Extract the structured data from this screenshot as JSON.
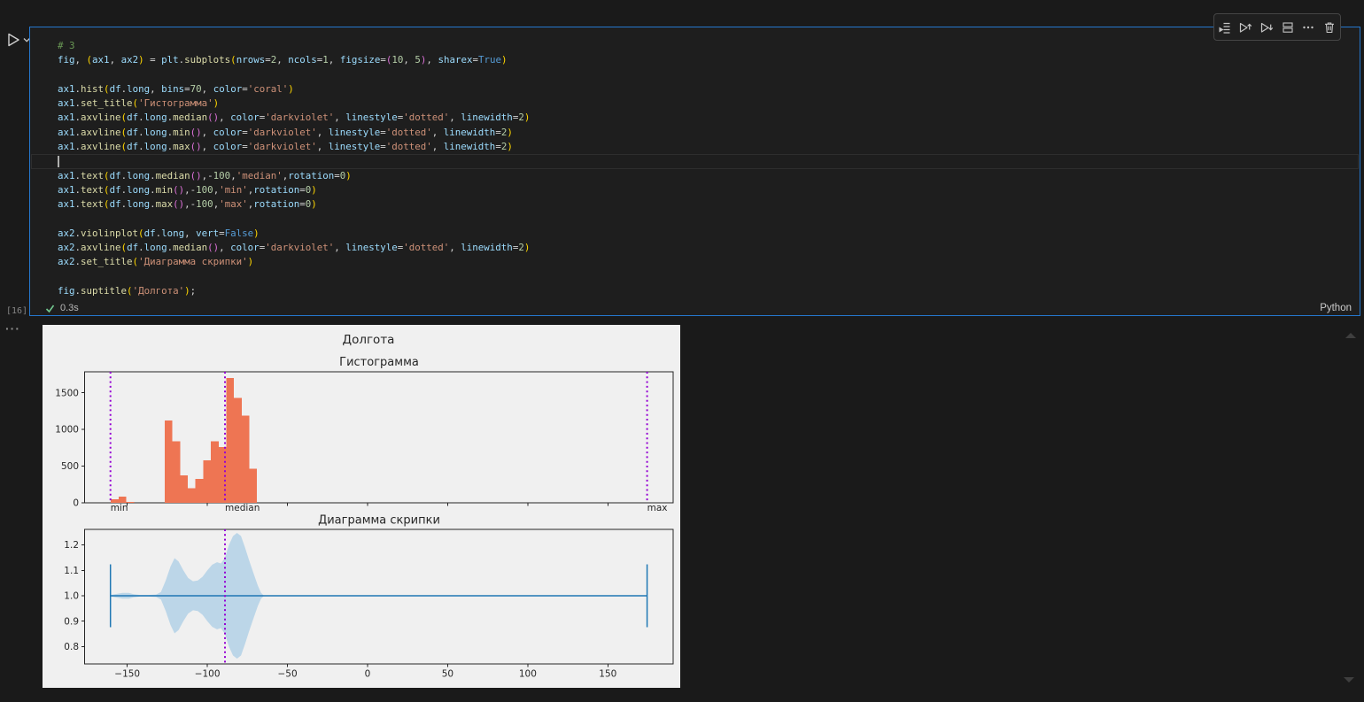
{
  "cell": {
    "execution_count": "[16]",
    "status": {
      "success": true,
      "duration": "0.3s",
      "language": "Python"
    },
    "cursor_line": 8,
    "code_lines": [
      [
        [
          "c",
          "# 3"
        ]
      ],
      [
        [
          "v",
          "fig"
        ],
        [
          "p",
          ", "
        ],
        [
          "b1",
          "("
        ],
        [
          "v",
          "ax1"
        ],
        [
          "p",
          ", "
        ],
        [
          "v",
          "ax2"
        ],
        [
          "b1",
          ")"
        ],
        [
          "p",
          " = "
        ],
        [
          "v",
          "plt"
        ],
        [
          "p",
          "."
        ],
        [
          "f",
          "subplots"
        ],
        [
          "b1",
          "("
        ],
        [
          "v",
          "nrows"
        ],
        [
          "p",
          "="
        ],
        [
          "n",
          "2"
        ],
        [
          "p",
          ", "
        ],
        [
          "v",
          "ncols"
        ],
        [
          "p",
          "="
        ],
        [
          "n",
          "1"
        ],
        [
          "p",
          ", "
        ],
        [
          "v",
          "figsize"
        ],
        [
          "p",
          "="
        ],
        [
          "b2",
          "("
        ],
        [
          "n",
          "10"
        ],
        [
          "p",
          ", "
        ],
        [
          "n",
          "5"
        ],
        [
          "b2",
          ")"
        ],
        [
          "p",
          ", "
        ],
        [
          "v",
          "sharex"
        ],
        [
          "p",
          "="
        ],
        [
          "k",
          "True"
        ],
        [
          "b1",
          ")"
        ]
      ],
      [],
      [
        [
          "v",
          "ax1"
        ],
        [
          "p",
          "."
        ],
        [
          "f",
          "hist"
        ],
        [
          "b1",
          "("
        ],
        [
          "v",
          "df"
        ],
        [
          "p",
          "."
        ],
        [
          "v",
          "long"
        ],
        [
          "p",
          ", "
        ],
        [
          "v",
          "bins"
        ],
        [
          "p",
          "="
        ],
        [
          "n",
          "70"
        ],
        [
          "p",
          ", "
        ],
        [
          "v",
          "color"
        ],
        [
          "p",
          "="
        ],
        [
          "s",
          "'coral'"
        ],
        [
          "b1",
          ")"
        ]
      ],
      [
        [
          "v",
          "ax1"
        ],
        [
          "p",
          "."
        ],
        [
          "f",
          "set_title"
        ],
        [
          "b1",
          "("
        ],
        [
          "s",
          "'Гистограмма'"
        ],
        [
          "b1",
          ")"
        ]
      ],
      [
        [
          "v",
          "ax1"
        ],
        [
          "p",
          "."
        ],
        [
          "f",
          "axvline"
        ],
        [
          "b1",
          "("
        ],
        [
          "v",
          "df"
        ],
        [
          "p",
          "."
        ],
        [
          "v",
          "long"
        ],
        [
          "p",
          "."
        ],
        [
          "f",
          "median"
        ],
        [
          "b2",
          "()"
        ],
        [
          "p",
          ", "
        ],
        [
          "v",
          "color"
        ],
        [
          "p",
          "="
        ],
        [
          "s",
          "'darkviolet'"
        ],
        [
          "p",
          ", "
        ],
        [
          "v",
          "linestyle"
        ],
        [
          "p",
          "="
        ],
        [
          "s",
          "'dotted'"
        ],
        [
          "p",
          ", "
        ],
        [
          "v",
          "linewidth"
        ],
        [
          "p",
          "="
        ],
        [
          "n",
          "2"
        ],
        [
          "b1",
          ")"
        ]
      ],
      [
        [
          "v",
          "ax1"
        ],
        [
          "p",
          "."
        ],
        [
          "f",
          "axvline"
        ],
        [
          "b1",
          "("
        ],
        [
          "v",
          "df"
        ],
        [
          "p",
          "."
        ],
        [
          "v",
          "long"
        ],
        [
          "p",
          "."
        ],
        [
          "f",
          "min"
        ],
        [
          "b2",
          "()"
        ],
        [
          "p",
          ", "
        ],
        [
          "v",
          "color"
        ],
        [
          "p",
          "="
        ],
        [
          "s",
          "'darkviolet'"
        ],
        [
          "p",
          ", "
        ],
        [
          "v",
          "linestyle"
        ],
        [
          "p",
          "="
        ],
        [
          "s",
          "'dotted'"
        ],
        [
          "p",
          ", "
        ],
        [
          "v",
          "linewidth"
        ],
        [
          "p",
          "="
        ],
        [
          "n",
          "2"
        ],
        [
          "b1",
          ")"
        ]
      ],
      [
        [
          "v",
          "ax1"
        ],
        [
          "p",
          "."
        ],
        [
          "f",
          "axvline"
        ],
        [
          "b1",
          "("
        ],
        [
          "v",
          "df"
        ],
        [
          "p",
          "."
        ],
        [
          "v",
          "long"
        ],
        [
          "p",
          "."
        ],
        [
          "f",
          "max"
        ],
        [
          "b2",
          "()"
        ],
        [
          "p",
          ", "
        ],
        [
          "v",
          "color"
        ],
        [
          "p",
          "="
        ],
        [
          "s",
          "'darkviolet'"
        ],
        [
          "p",
          ", "
        ],
        [
          "v",
          "linestyle"
        ],
        [
          "p",
          "="
        ],
        [
          "s",
          "'dotted'"
        ],
        [
          "p",
          ", "
        ],
        [
          "v",
          "linewidth"
        ],
        [
          "p",
          "="
        ],
        [
          "n",
          "2"
        ],
        [
          "b1",
          ")"
        ]
      ],
      [],
      [
        [
          "v",
          "ax1"
        ],
        [
          "p",
          "."
        ],
        [
          "f",
          "text"
        ],
        [
          "b1",
          "("
        ],
        [
          "v",
          "df"
        ],
        [
          "p",
          "."
        ],
        [
          "v",
          "long"
        ],
        [
          "p",
          "."
        ],
        [
          "f",
          "median"
        ],
        [
          "b2",
          "()"
        ],
        [
          "p",
          ",-"
        ],
        [
          "n",
          "100"
        ],
        [
          "p",
          ","
        ],
        [
          "s",
          "'median'"
        ],
        [
          "p",
          ","
        ],
        [
          "v",
          "rotation"
        ],
        [
          "p",
          "="
        ],
        [
          "n",
          "0"
        ],
        [
          "b1",
          ")"
        ]
      ],
      [
        [
          "v",
          "ax1"
        ],
        [
          "p",
          "."
        ],
        [
          "f",
          "text"
        ],
        [
          "b1",
          "("
        ],
        [
          "v",
          "df"
        ],
        [
          "p",
          "."
        ],
        [
          "v",
          "long"
        ],
        [
          "p",
          "."
        ],
        [
          "f",
          "min"
        ],
        [
          "b2",
          "()"
        ],
        [
          "p",
          ",-"
        ],
        [
          "n",
          "100"
        ],
        [
          "p",
          ","
        ],
        [
          "s",
          "'min'"
        ],
        [
          "p",
          ","
        ],
        [
          "v",
          "rotation"
        ],
        [
          "p",
          "="
        ],
        [
          "n",
          "0"
        ],
        [
          "b1",
          ")"
        ]
      ],
      [
        [
          "v",
          "ax1"
        ],
        [
          "p",
          "."
        ],
        [
          "f",
          "text"
        ],
        [
          "b1",
          "("
        ],
        [
          "v",
          "df"
        ],
        [
          "p",
          "."
        ],
        [
          "v",
          "long"
        ],
        [
          "p",
          "."
        ],
        [
          "f",
          "max"
        ],
        [
          "b2",
          "()"
        ],
        [
          "p",
          ",-"
        ],
        [
          "n",
          "100"
        ],
        [
          "p",
          ","
        ],
        [
          "s",
          "'max'"
        ],
        [
          "p",
          ","
        ],
        [
          "v",
          "rotation"
        ],
        [
          "p",
          "="
        ],
        [
          "n",
          "0"
        ],
        [
          "b1",
          ")"
        ]
      ],
      [],
      [
        [
          "v",
          "ax2"
        ],
        [
          "p",
          "."
        ],
        [
          "f",
          "violinplot"
        ],
        [
          "b1",
          "("
        ],
        [
          "v",
          "df"
        ],
        [
          "p",
          "."
        ],
        [
          "v",
          "long"
        ],
        [
          "p",
          ", "
        ],
        [
          "v",
          "vert"
        ],
        [
          "p",
          "="
        ],
        [
          "k",
          "False"
        ],
        [
          "b1",
          ")"
        ]
      ],
      [
        [
          "v",
          "ax2"
        ],
        [
          "p",
          "."
        ],
        [
          "f",
          "axvline"
        ],
        [
          "b1",
          "("
        ],
        [
          "v",
          "df"
        ],
        [
          "p",
          "."
        ],
        [
          "v",
          "long"
        ],
        [
          "p",
          "."
        ],
        [
          "f",
          "median"
        ],
        [
          "b2",
          "()"
        ],
        [
          "p",
          ", "
        ],
        [
          "v",
          "color"
        ],
        [
          "p",
          "="
        ],
        [
          "s",
          "'darkviolet'"
        ],
        [
          "p",
          ", "
        ],
        [
          "v",
          "linestyle"
        ],
        [
          "p",
          "="
        ],
        [
          "s",
          "'dotted'"
        ],
        [
          "p",
          ", "
        ],
        [
          "v",
          "linewidth"
        ],
        [
          "p",
          "="
        ],
        [
          "n",
          "2"
        ],
        [
          "b1",
          ")"
        ]
      ],
      [
        [
          "v",
          "ax2"
        ],
        [
          "p",
          "."
        ],
        [
          "f",
          "set_title"
        ],
        [
          "b1",
          "("
        ],
        [
          "s",
          "'Диаграмма скрипки'"
        ],
        [
          "b1",
          ")"
        ]
      ],
      [],
      [
        [
          "v",
          "fig"
        ],
        [
          "p",
          "."
        ],
        [
          "f",
          "suptitle"
        ],
        [
          "b1",
          "("
        ],
        [
          "s",
          "'Долгота'"
        ],
        [
          "b1",
          ")"
        ],
        [
          "p",
          ";"
        ]
      ]
    ]
  },
  "toolbar": {
    "icons": [
      "run-by-line-icon",
      "execute-above-icon",
      "execute-below-icon",
      "split-cell-icon",
      "more-actions-icon",
      "delete-cell-icon"
    ]
  },
  "output": {
    "options_label": "···"
  },
  "colors": {
    "focus_border": "#2577cd",
    "fig_bg": "#f0f0f0",
    "plot_text": "#262626",
    "spine": "#262626",
    "hist_bar": "#ee7553",
    "stat_line": "#9400d3",
    "violin_fill": "#bcd6e8",
    "violin_line": "#1f77b4",
    "check_green": "#73c991",
    "code": {
      "c": "#6a9955",
      "v": "#9cdcfe",
      "f": "#dcdcaa",
      "n": "#b5cea8",
      "s": "#ce9178",
      "k": "#569cd6",
      "p": "#d4d4d4",
      "b1": "#ffd700",
      "b2": "#da70d6"
    }
  },
  "chart_data": [
    {
      "type": "bar",
      "subtype": "histogram",
      "suptitle": "Долгота",
      "title": "Гистограмма",
      "series_color_name": "coral",
      "bin_width": 4.8,
      "bars": [
        [
          -160.2,
          48
        ],
        [
          -155.4,
          85
        ],
        [
          -150.6,
          14
        ],
        [
          -126.6,
          1120
        ],
        [
          -121.8,
          840
        ],
        [
          -117.0,
          376
        ],
        [
          -112.2,
          200
        ],
        [
          -107.4,
          324
        ],
        [
          -102.6,
          576
        ],
        [
          -97.8,
          840
        ],
        [
          -93.0,
          762
        ],
        [
          -88.2,
          1702
        ],
        [
          -83.4,
          1431
        ],
        [
          -78.6,
          1186
        ],
        [
          -73.8,
          462
        ]
      ],
      "ylabel": "",
      "xlabel": "",
      "yticks": [
        "0",
        "500",
        "1000",
        "1500"
      ],
      "ytick_values": [
        0,
        500,
        1000,
        1500
      ],
      "ylim": [
        0,
        1785
      ],
      "xlim": [
        -176.6,
        190.8
      ],
      "stat_lines": {
        "min": -160.5,
        "median": -89.0,
        "max": 174.5
      },
      "stat_labels": [
        "min",
        "median",
        "max"
      ],
      "annotation_y": -100,
      "grid": false
    },
    {
      "type": "area",
      "subtype": "violin-horizontal",
      "title": "Диаграмма скрипки",
      "center_y": 1.0,
      "data_range": [
        -160.5,
        174.5
      ],
      "median": -89.0,
      "cap_half_height": 0.1235,
      "yticks": [
        "0.8",
        "0.9",
        "1.0",
        "1.1",
        "1.2"
      ],
      "ytick_values": [
        0.8,
        0.9,
        1.0,
        1.1,
        1.2
      ],
      "xticks": [
        "−150",
        "−100",
        "−50",
        "0",
        "50",
        "100",
        "150"
      ],
      "xtick_values": [
        -150,
        -100,
        -50,
        0,
        50,
        100,
        150
      ],
      "ylim": [
        0.732,
        1.261
      ],
      "grid": false,
      "kde": [
        [
          -160.5,
          0.003
        ],
        [
          -157,
          0.007
        ],
        [
          -153,
          0.011
        ],
        [
          -149,
          0.011
        ],
        [
          -146,
          0.006
        ],
        [
          -142,
          0.003
        ],
        [
          -137,
          0.003
        ],
        [
          -132,
          0.005
        ],
        [
          -129,
          0.015
        ],
        [
          -126,
          0.06
        ],
        [
          -123,
          0.115
        ],
        [
          -120.5,
          0.148
        ],
        [
          -118,
          0.135
        ],
        [
          -115,
          0.1
        ],
        [
          -112,
          0.07
        ],
        [
          -109,
          0.057
        ],
        [
          -106,
          0.06
        ],
        [
          -103,
          0.075
        ],
        [
          -100,
          0.1
        ],
        [
          -97,
          0.122
        ],
        [
          -94,
          0.132
        ],
        [
          -91.5,
          0.127
        ],
        [
          -89,
          0.15
        ],
        [
          -86.5,
          0.2
        ],
        [
          -84,
          0.235
        ],
        [
          -81.5,
          0.247
        ],
        [
          -79,
          0.235
        ],
        [
          -76.5,
          0.19
        ],
        [
          -74,
          0.14
        ],
        [
          -71,
          0.085
        ],
        [
          -68.5,
          0.04
        ],
        [
          -66.5,
          0.012
        ],
        [
          -65,
          0.002
        ]
      ]
    }
  ]
}
